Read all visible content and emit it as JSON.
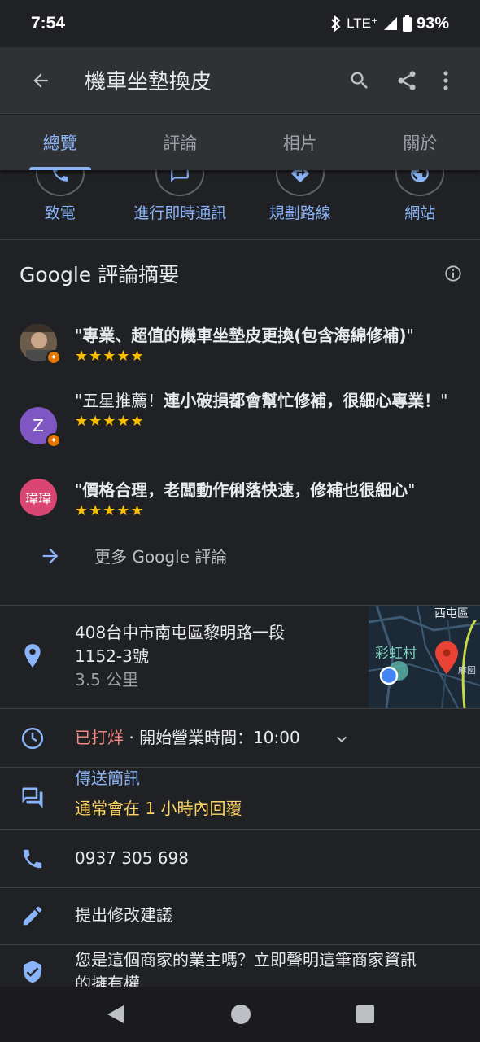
{
  "status": {
    "time": "7:54",
    "network": "LTE⁺",
    "battery": "93%"
  },
  "appbar": {
    "title": "機車坐墊換皮"
  },
  "tabs": [
    "總覽",
    "評論",
    "相片",
    "關於"
  ],
  "actions": [
    "致電",
    "進行即時通訊",
    "規劃路線",
    "網站"
  ],
  "summary": {
    "title": "Google 評論摘要",
    "reviews": [
      {
        "quote_pre": "\"",
        "quote_bold": "專業、超值的機車坐墊皮更換(包含海綿修補)",
        "quote_post": "\"",
        "stars": "★★★★★"
      },
      {
        "quote_pre": "\"五星推薦！",
        "quote_bold": "連小破損都會幫忙修補，很細心專業！",
        "quote_post": "\"",
        "stars": "★★★★★",
        "avatar_text": "Z"
      },
      {
        "quote_pre": "\"",
        "quote_bold": "價格合理，老闆動作俐落快速，修補也很細心",
        "quote_post": "\"",
        "stars": "★★★★★",
        "avatar_text": "瑋瑋"
      }
    ],
    "more_label": "更多 Google 評論"
  },
  "address": {
    "line1": "408台中市南屯區黎明路一段",
    "line2": "1152-3號",
    "distance": "3.5 公里",
    "map_labels": {
      "district": "西屯區",
      "place": "彩虹村",
      "partial": "麻園"
    }
  },
  "hours": {
    "status": "已打烊",
    "detail": " · 開始營業時間：10:00"
  },
  "message": {
    "label": "傳送簡訊",
    "reply": "通常會在 1 小時內回覆"
  },
  "phone": "0937 305 698",
  "suggest": "提出修改建議",
  "claim": {
    "line1": "您是這個商家的業主嗎？立即聲明這筆商家資訊",
    "line2": "的擁有權"
  },
  "colors": {
    "accent": "#8ab4f8",
    "star": "#fbbc04",
    "closed": "#f28b82",
    "reply": "#fdd663"
  }
}
